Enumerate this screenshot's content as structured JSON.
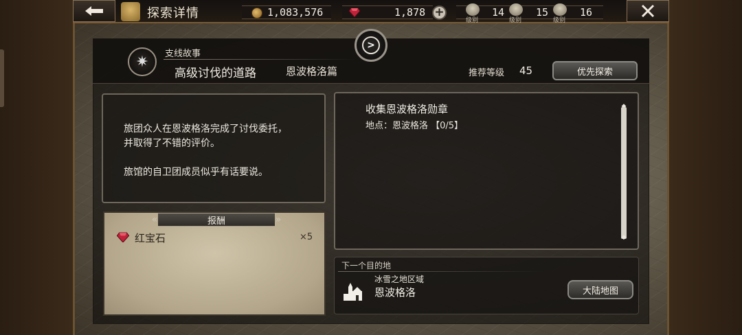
{
  "header": {
    "title": "探索详情",
    "back_icon": "back-arrow-icon",
    "close_icon": "close-icon"
  },
  "resources": {
    "gold": "1,083,576",
    "ruby": "1,878",
    "medals": [
      {
        "label": "级别",
        "value": "14"
      },
      {
        "label": "级别",
        "value": "15"
      },
      {
        "label": "级别",
        "value": "16"
      }
    ]
  },
  "quest": {
    "type": "支线故事",
    "name": "高级讨伐的道路",
    "chapter": "恩波格洛篇",
    "recommended_label": "推荐等级",
    "recommended_level": "45",
    "priority_button": "优先探索"
  },
  "description": {
    "lines": [
      "旅团众人在恩波格洛完成了讨伐委托，",
      "并取得了不错的评价。",
      "",
      "旅馆的自卫团成员似乎有话要说。"
    ]
  },
  "reward": {
    "tab_label": "报酬",
    "items": [
      {
        "name": "红宝石",
        "quantity": "×5"
      }
    ]
  },
  "objective": {
    "title": "收集恩波格洛勋章",
    "location": "地点：恩波格洛 【0/5】"
  },
  "next_destination": {
    "label": "下一个目的地",
    "region": "冰雪之地区域",
    "town": "恩波格洛",
    "map_button": "大陆地图"
  },
  "colors": {
    "ruby": "#c0223a",
    "gold": "#d9b060",
    "frame": "#7a5b36"
  }
}
